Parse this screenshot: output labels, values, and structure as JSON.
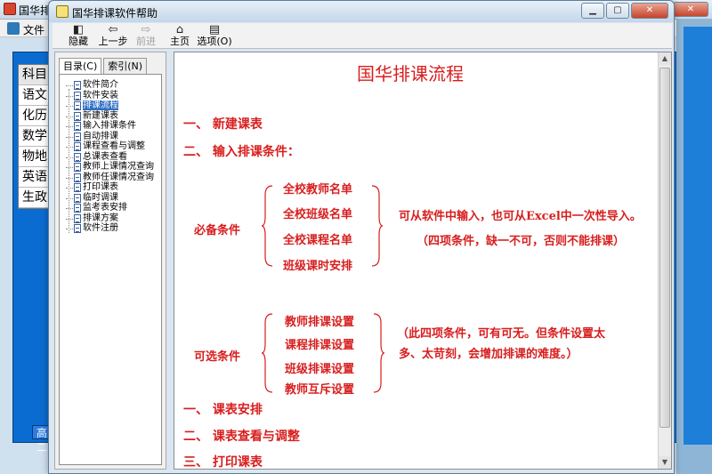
{
  "background_window": {
    "title": "国华排课",
    "menu_file": "文件",
    "subjects": [
      "科目",
      "语文",
      "化历",
      "数学",
      "物地",
      "英语",
      "生政"
    ],
    "status_cell": "高二"
  },
  "help_window": {
    "title": "国华排课软件帮助",
    "toolbar": {
      "hide": "隐藏",
      "back": "上一步",
      "forward": "前进",
      "home": "主页",
      "options": "选项(O)"
    },
    "tabs": {
      "contents": "目录(C)",
      "index": "索引(N)"
    },
    "tree_items": [
      "软件简介",
      "软件安装",
      "排课流程",
      "新建课表",
      "输入排课条件",
      "自动排课",
      "课程查看与调整",
      "总课表查看",
      "教师上课情况查询",
      "教师任课情况查询",
      "打印课表",
      "临时调课",
      "监考表安排",
      "排课方案",
      "软件注册"
    ],
    "selected_tree_item": "排课流程"
  },
  "content": {
    "title": "国华排课流程",
    "section1": "一、 新建课表",
    "section2": "二、 输入排课条件：",
    "required_label": "必备条件",
    "required_items": [
      "全校教师名单",
      "全校班级名单",
      "全校课程名单",
      "班级课时安排"
    ],
    "required_note1": "可从软件中输入，也可从Excel中一次性导入。",
    "required_note2": "（四项条件，缺一不可，否则不能排课）",
    "optional_label": "可选条件",
    "optional_items": [
      "教师排课设置",
      "课程排课设置",
      "班级排课设置",
      "教师互斥设置"
    ],
    "optional_note1": "（此四项条件，可有可无。但条件设置太",
    "optional_note2": "多、太苛刻，会增加排课的难度。）",
    "section3": "一、 课表安排",
    "section4": "二、 课表查看与调整",
    "section5_partial": "三、 打印课表"
  },
  "colors": {
    "accent_red": "#d81e1e",
    "selection_blue": "#2f6fc6"
  }
}
